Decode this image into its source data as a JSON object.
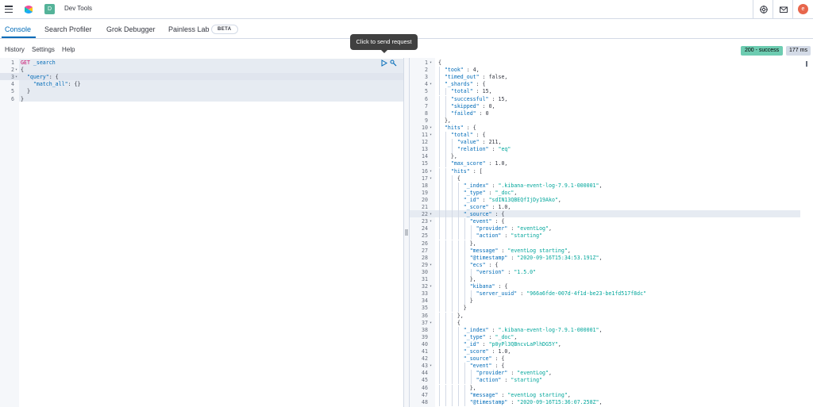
{
  "header": {
    "space_initial": "D",
    "breadcrumb": "Dev Tools",
    "avatar_initial": "e"
  },
  "tabs": [
    {
      "label": "Console",
      "active": true
    },
    {
      "label": "Search Profiler"
    },
    {
      "label": "Grok Debugger"
    },
    {
      "label": "Painless Lab"
    }
  ],
  "beta_badge": "BETA",
  "subnav": [
    "History",
    "Settings",
    "Help"
  ],
  "response_status": "200 - success",
  "response_time": "177 ms",
  "tooltip": "Click to send request",
  "request": {
    "lines": [
      [
        "GET",
        " _search"
      ],
      [
        "{"
      ],
      [
        "  \"query\": {"
      ],
      [
        "    \"match_all\": {}"
      ],
      [
        "  }"
      ],
      [
        "}"
      ]
    ],
    "line_numbers": [
      "1",
      "2",
      "3",
      "4",
      "5",
      "6"
    ]
  },
  "response_lines": [
    "{",
    "  \"took\" : 4,",
    "  \"timed_out\" : false,",
    "  \"_shards\" : {",
    "    \"total\" : 15,",
    "    \"successful\" : 15,",
    "    \"skipped\" : 0,",
    "    \"failed\" : 0",
    "  },",
    "  \"hits\" : {",
    "    \"total\" : {",
    "      \"value\" : 211,",
    "      \"relation\" : \"eq\"",
    "    },",
    "    \"max_score\" : 1.0,",
    "    \"hits\" : [",
    "      {",
    "        \"_index\" : \".kibana-event-log-7.9.1-000001\",",
    "        \"_type\" : \"_doc\",",
    "        \"_id\" : \"sdIN13QBEQfIjDy19Ako\",",
    "        \"_score\" : 1.0,",
    "        \"_source\" : {",
    "          \"event\" : {",
    "            \"provider\" : \"eventLog\",",
    "            \"action\" : \"starting\"",
    "          },",
    "          \"message\" : \"eventLog starting\",",
    "          \"@timestamp\" : \"2020-09-16T15:34:53.191Z\",",
    "          \"ecs\" : {",
    "            \"version\" : \"1.5.0\"",
    "          },",
    "          \"kibana\" : {",
    "            \"server_uuid\" : \"966a6fde-007d-4f1d-be23-be1fd517f8dc\"",
    "          }",
    "        }",
    "      },",
    "      {",
    "        \"_index\" : \".kibana-event-log-7.9.1-000001\",",
    "        \"_type\" : \"_doc\",",
    "        \"_id\" : \"p0yPl3QBncvLaPlhDG5Y\",",
    "        \"_score\" : 1.0,",
    "        \"_source\" : {",
    "          \"event\" : {",
    "            \"provider\" : \"eventLog\",",
    "            \"action\" : \"starting\"",
    "          },",
    "          \"message\" : \"eventLog starting\",",
    "          \"@timestamp\" : \"2020-09-16T15:36:07.258Z\","
  ]
}
